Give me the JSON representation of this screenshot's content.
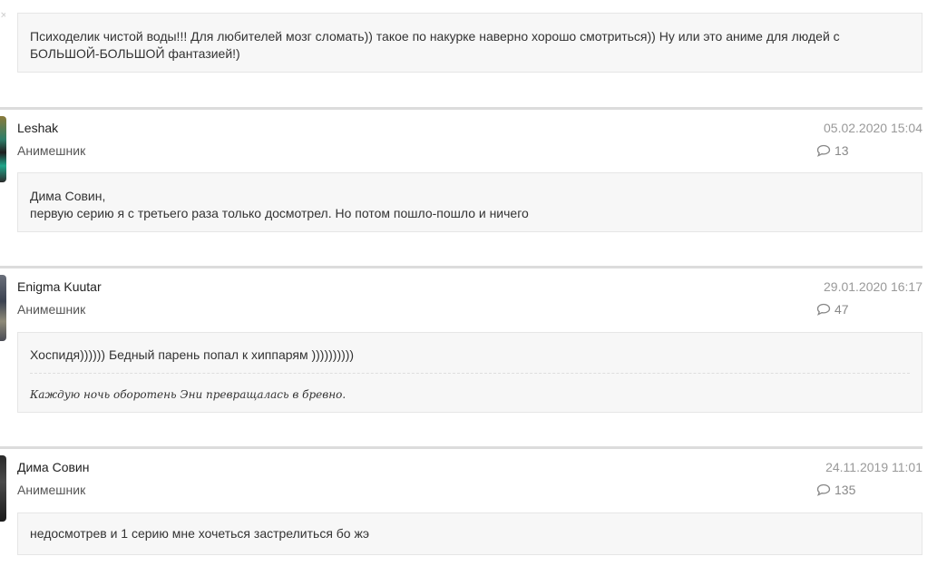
{
  "colors": {
    "box_bg": "#f7f7f7",
    "separator": "#dcdcdc",
    "meta_text": "#999999"
  },
  "top_comment": {
    "text_line1": "Психоделик чистой воды!!! Для любителей мозг сломать)) такое по накурке наверно хорошо смотриться)) Ну или это аниме для людей с",
    "text_line2": "БОЛЬШОЙ-БОЛЬШОЙ фантазией!)"
  },
  "comments": [
    {
      "author": "Leshak",
      "role": "Анимешник",
      "date": "05.02.2020 15:04",
      "count": "13",
      "text_line1": "Дима Совин,",
      "text_line2": "первую серию я с третьего раза только досмотрел. Но потом пошло-пошло и ничего"
    },
    {
      "author": "Enigma Kuutar",
      "role": "Анимешник",
      "date": "29.01.2020 16:17",
      "count": "47",
      "text": "Хоспидя)))))) Бедный парень попал к хиппарям ))))))))))",
      "signature": "Каждую ночь оборотень Эни превращалась в бревно."
    },
    {
      "author": "Дима Совин",
      "role": "Анимешник",
      "date": "24.11.2019 11:01",
      "count": "135",
      "text": "недосмотрев и 1 серию мне хочеться застрелиться бо жэ"
    }
  ]
}
